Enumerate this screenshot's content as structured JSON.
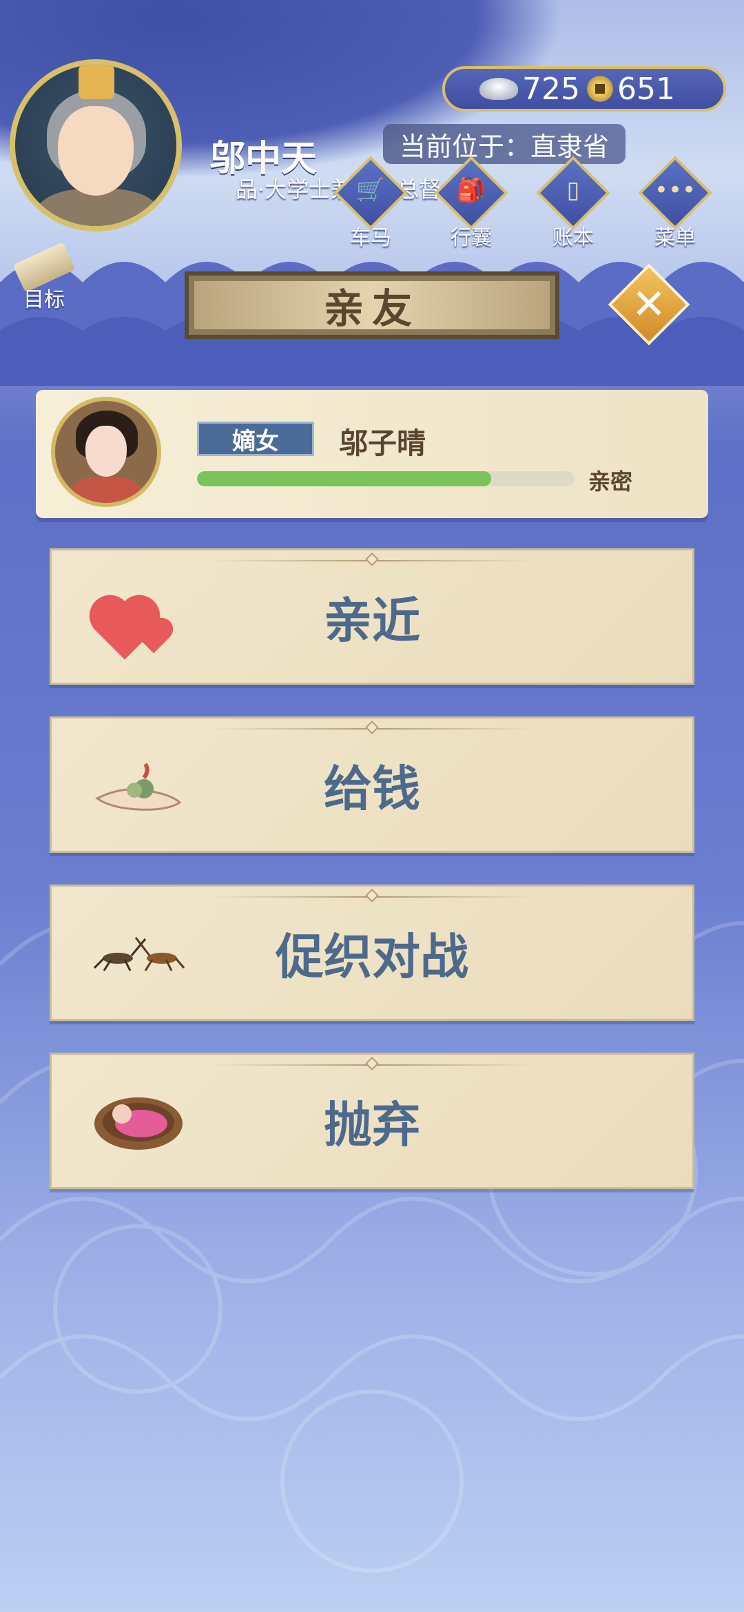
{
  "player": {
    "name": "邬中天",
    "rank": "品·大学士兼直隶总督",
    "location": "当前位于：直隶省"
  },
  "currency": {
    "silver": "725",
    "copper": "651"
  },
  "nav": {
    "carriage": "车马",
    "bag": "行囊",
    "ledger": "账本",
    "menu": "菜单",
    "target": "目标"
  },
  "page": {
    "title": "亲友"
  },
  "person": {
    "role": "嫡女",
    "name": "邬子晴",
    "relation_label": "亲密",
    "relation_level": 0.78
  },
  "actions": [
    {
      "label": "亲近",
      "icon": "hearts-icon"
    },
    {
      "label": "给钱",
      "icon": "hand-money-icon"
    },
    {
      "label": "促织对战",
      "icon": "crickets-icon"
    },
    {
      "label": "抛弃",
      "icon": "baby-basket-icon"
    }
  ],
  "colors": {
    "accent_gold": "#d8c06a",
    "action_text": "#4d6a8c",
    "bar_fill": "#7ac35a"
  }
}
